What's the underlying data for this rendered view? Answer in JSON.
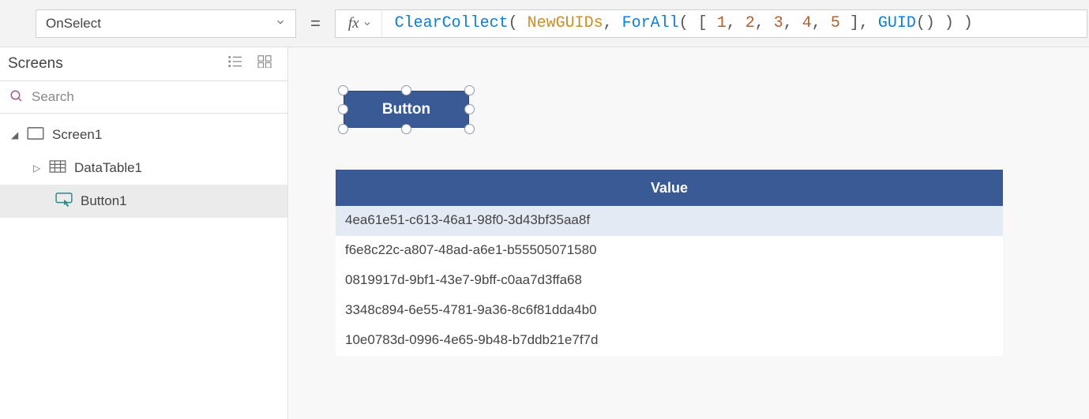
{
  "property_dropdown": {
    "value": "OnSelect"
  },
  "formula": {
    "tokens": [
      {
        "t": "ClearCollect",
        "c": "fn"
      },
      {
        "t": "( ",
        "c": "p"
      },
      {
        "t": "NewGUIDs",
        "c": "id"
      },
      {
        "t": ", ",
        "c": "p"
      },
      {
        "t": "ForAll",
        "c": "fn"
      },
      {
        "t": "( [ ",
        "c": "p"
      },
      {
        "t": "1",
        "c": "num"
      },
      {
        "t": ", ",
        "c": "p"
      },
      {
        "t": "2",
        "c": "num"
      },
      {
        "t": ", ",
        "c": "p"
      },
      {
        "t": "3",
        "c": "num"
      },
      {
        "t": ", ",
        "c": "p"
      },
      {
        "t": "4",
        "c": "num"
      },
      {
        "t": ", ",
        "c": "p"
      },
      {
        "t": "5",
        "c": "num"
      },
      {
        "t": " ], ",
        "c": "p"
      },
      {
        "t": "GUID",
        "c": "fn"
      },
      {
        "t": "() ) )",
        "c": "p"
      }
    ]
  },
  "panel": {
    "title": "Screens",
    "search_placeholder": "Search"
  },
  "tree": {
    "screen_label": "Screen1",
    "datatable_label": "DataTable1",
    "button_label": "Button1"
  },
  "canvas": {
    "button_text": "Button"
  },
  "table": {
    "header": "Value",
    "rows": [
      "4ea61e51-c613-46a1-98f0-3d43bf35aa8f",
      "f6e8c22c-a807-48ad-a6e1-b55505071580",
      "0819917d-9bf1-43e7-9bff-c0aa7d3ffa68",
      "3348c894-6e55-4781-9a36-8c6f81dda4b0",
      "10e0783d-0996-4e65-9b48-b7ddb21e7f7d"
    ]
  },
  "equals_sign": "="
}
